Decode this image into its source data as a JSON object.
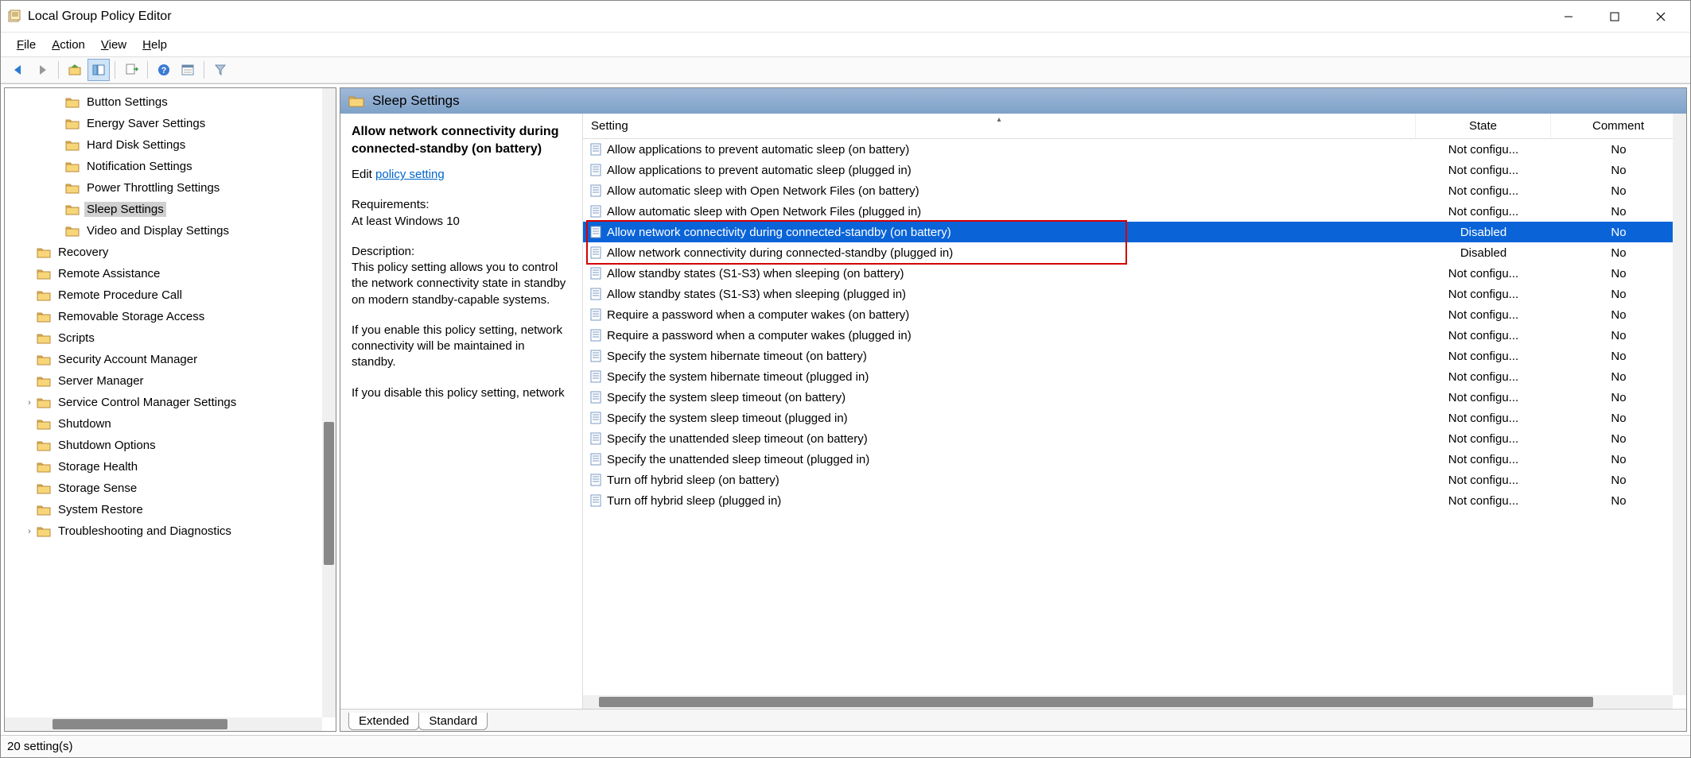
{
  "window": {
    "title": "Local Group Policy Editor"
  },
  "menubar": {
    "file": "File",
    "action": "Action",
    "view": "View",
    "help": "Help"
  },
  "tree": {
    "items": [
      {
        "label": "Button Settings",
        "indent": 2,
        "expander": ""
      },
      {
        "label": "Energy Saver Settings",
        "indent": 2,
        "expander": ""
      },
      {
        "label": "Hard Disk Settings",
        "indent": 2,
        "expander": ""
      },
      {
        "label": "Notification Settings",
        "indent": 2,
        "expander": ""
      },
      {
        "label": "Power Throttling Settings",
        "indent": 2,
        "expander": ""
      },
      {
        "label": "Sleep Settings",
        "indent": 2,
        "expander": "",
        "selected": true
      },
      {
        "label": "Video and Display Settings",
        "indent": 2,
        "expander": ""
      },
      {
        "label": "Recovery",
        "indent": 1,
        "expander": ""
      },
      {
        "label": "Remote Assistance",
        "indent": 1,
        "expander": ""
      },
      {
        "label": "Remote Procedure Call",
        "indent": 1,
        "expander": ""
      },
      {
        "label": "Removable Storage Access",
        "indent": 1,
        "expander": ""
      },
      {
        "label": "Scripts",
        "indent": 1,
        "expander": ""
      },
      {
        "label": "Security Account Manager",
        "indent": 1,
        "expander": ""
      },
      {
        "label": "Server Manager",
        "indent": 1,
        "expander": ""
      },
      {
        "label": "Service Control Manager Settings",
        "indent": 1,
        "expander": "›"
      },
      {
        "label": "Shutdown",
        "indent": 1,
        "expander": ""
      },
      {
        "label": "Shutdown Options",
        "indent": 1,
        "expander": ""
      },
      {
        "label": "Storage Health",
        "indent": 1,
        "expander": ""
      },
      {
        "label": "Storage Sense",
        "indent": 1,
        "expander": ""
      },
      {
        "label": "System Restore",
        "indent": 1,
        "expander": ""
      },
      {
        "label": "Troubleshooting and Diagnostics",
        "indent": 1,
        "expander": "›"
      }
    ]
  },
  "breadcrumb": {
    "title": "Sleep Settings"
  },
  "extended": {
    "policy_title": "Allow network connectivity during connected-standby (on battery)",
    "edit_label": "Edit ",
    "edit_link": "policy setting ",
    "req_label": "Requirements:",
    "req_text": "At least Windows 10",
    "desc_label": "Description:",
    "desc_p1": "This policy setting allows you to control the network connectivity state in standby on modern standby-capable systems.",
    "desc_p2": "If you enable this policy setting, network connectivity will be maintained in standby.",
    "desc_p3": "If you disable this policy setting, network"
  },
  "columns": {
    "setting": "Setting",
    "state": "State",
    "comment": "Comment"
  },
  "rows": [
    {
      "name": "Allow applications to prevent automatic sleep (on battery)",
      "state": "Not configu...",
      "comment": "No"
    },
    {
      "name": "Allow applications to prevent automatic sleep (plugged in)",
      "state": "Not configu...",
      "comment": "No"
    },
    {
      "name": "Allow automatic sleep with Open Network Files (on battery)",
      "state": "Not configu...",
      "comment": "No"
    },
    {
      "name": "Allow automatic sleep with Open Network Files (plugged in)",
      "state": "Not configu...",
      "comment": "No"
    },
    {
      "name": "Allow network connectivity during connected-standby (on battery)",
      "state": "Disabled",
      "comment": "No",
      "selected": true
    },
    {
      "name": "Allow network connectivity during connected-standby (plugged in)",
      "state": "Disabled",
      "comment": "No"
    },
    {
      "name": "Allow standby states (S1-S3) when sleeping (on battery)",
      "state": "Not configu...",
      "comment": "No"
    },
    {
      "name": "Allow standby states (S1-S3) when sleeping (plugged in)",
      "state": "Not configu...",
      "comment": "No"
    },
    {
      "name": "Require a password when a computer wakes (on battery)",
      "state": "Not configu...",
      "comment": "No"
    },
    {
      "name": "Require a password when a computer wakes (plugged in)",
      "state": "Not configu...",
      "comment": "No"
    },
    {
      "name": "Specify the system hibernate timeout (on battery)",
      "state": "Not configu...",
      "comment": "No"
    },
    {
      "name": "Specify the system hibernate timeout (plugged in)",
      "state": "Not configu...",
      "comment": "No"
    },
    {
      "name": "Specify the system sleep timeout (on battery)",
      "state": "Not configu...",
      "comment": "No"
    },
    {
      "name": "Specify the system sleep timeout (plugged in)",
      "state": "Not configu...",
      "comment": "No"
    },
    {
      "name": "Specify the unattended sleep timeout (on battery)",
      "state": "Not configu...",
      "comment": "No"
    },
    {
      "name": "Specify the unattended sleep timeout (plugged in)",
      "state": "Not configu...",
      "comment": "No"
    },
    {
      "name": "Turn off hybrid sleep (on battery)",
      "state": "Not configu...",
      "comment": "No"
    },
    {
      "name": "Turn off hybrid sleep (plugged in)",
      "state": "Not configu...",
      "comment": "No"
    }
  ],
  "tabs": {
    "extended": "Extended",
    "standard": "Standard"
  },
  "status": {
    "text": "20 setting(s)"
  }
}
